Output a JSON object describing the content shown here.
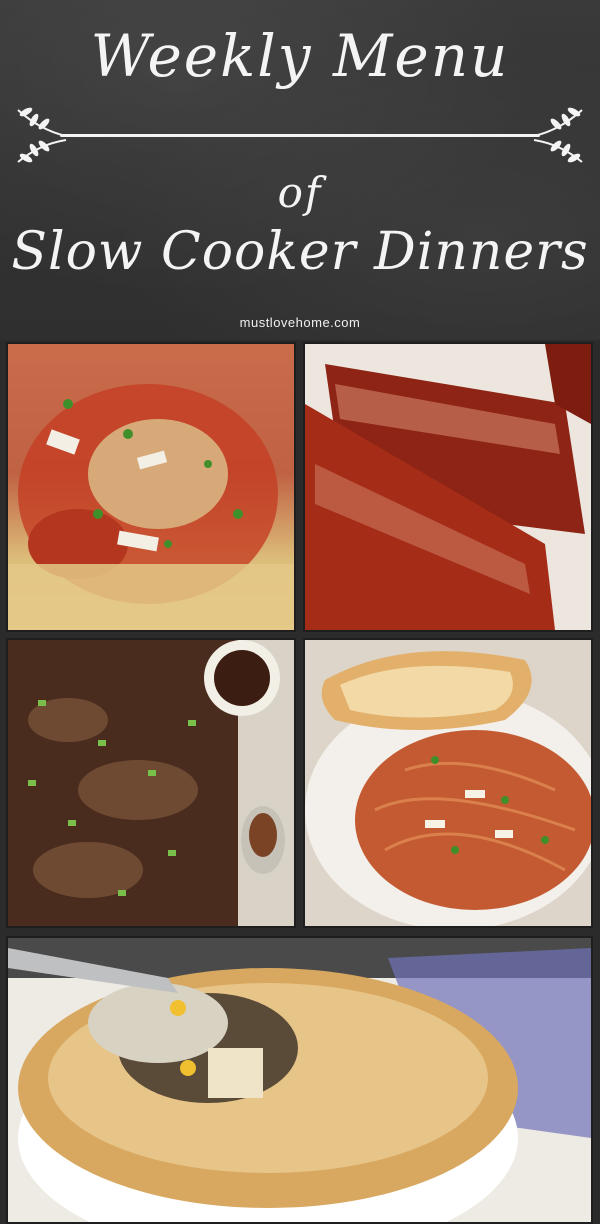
{
  "header": {
    "title_line1": "Weekly Menu",
    "title_of": "of",
    "title_line2": "Slow Cooker Dinners",
    "site": "mustlovehome.com"
  },
  "photos": [
    {
      "name": "chicken-cacciatore-spaghetti-photo"
    },
    {
      "name": "bbq-ribs-photo"
    },
    {
      "name": "teriyaki-chicken-photo"
    },
    {
      "name": "spaghetti-with-toast-photo"
    },
    {
      "name": "chicken-pot-pie-photo"
    }
  ],
  "colors": {
    "chalkboard": "#333333",
    "chalk": "#f4f4f4"
  }
}
